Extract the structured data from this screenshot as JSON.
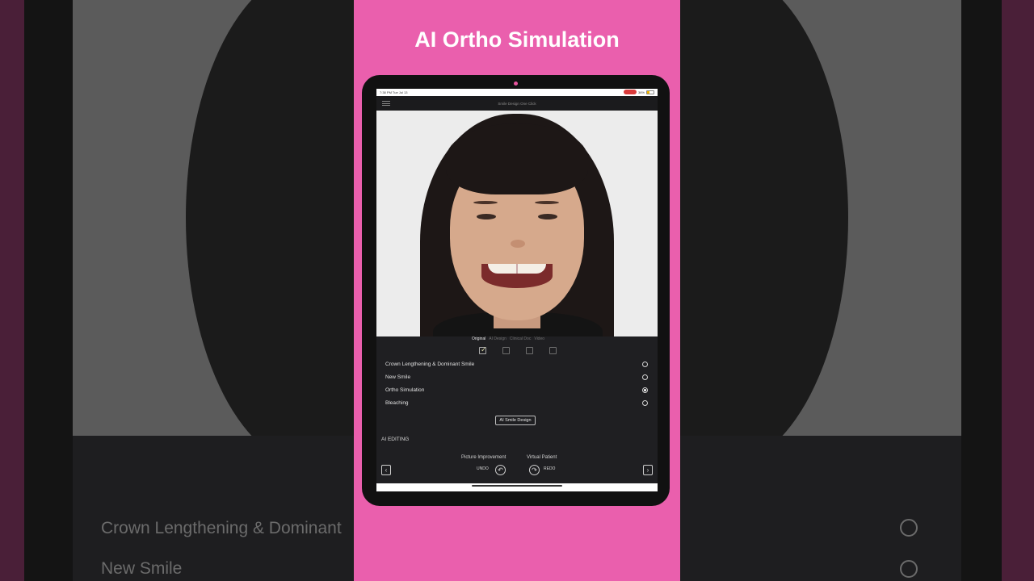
{
  "promo": {
    "title": "AI Ortho Simulation"
  },
  "status": {
    "time_date": "7:38 PM  Tue Jul 13",
    "battery": "36%"
  },
  "app": {
    "title": "Smile Design One Click"
  },
  "tabs": [
    {
      "label": "Original",
      "active": true
    },
    {
      "label": "AI Design",
      "active": false
    },
    {
      "label": "Clinical Doc",
      "active": false
    },
    {
      "label": "Video",
      "active": false
    }
  ],
  "checkboxes": [
    true,
    false,
    false,
    false
  ],
  "options": [
    {
      "label": "Crown Lengthening & Dominant Smile",
      "selected": false
    },
    {
      "label": "New Smile",
      "selected": false
    },
    {
      "label": "Ortho Simulation",
      "selected": true
    },
    {
      "label": "Bleaching",
      "selected": false
    }
  ],
  "ai_button": "AI Smile Design",
  "ai_editing": {
    "title": "AI EDITING",
    "picture_improvement": "Picture Improvement",
    "virtual_patient": "Virtual Patient",
    "undo": "UNDO",
    "redo": "REDO"
  },
  "background": {
    "option1": "Crown Lengthening & Dominant",
    "option2": "New Smile"
  },
  "colors": {
    "promo_pink": "#ea5fad",
    "app_dark": "#1f1f22"
  },
  "icons": [
    "menu-icon",
    "undo-icon",
    "redo-icon",
    "chevron-left-icon",
    "chevron-right-icon",
    "checkmark-icon"
  ]
}
